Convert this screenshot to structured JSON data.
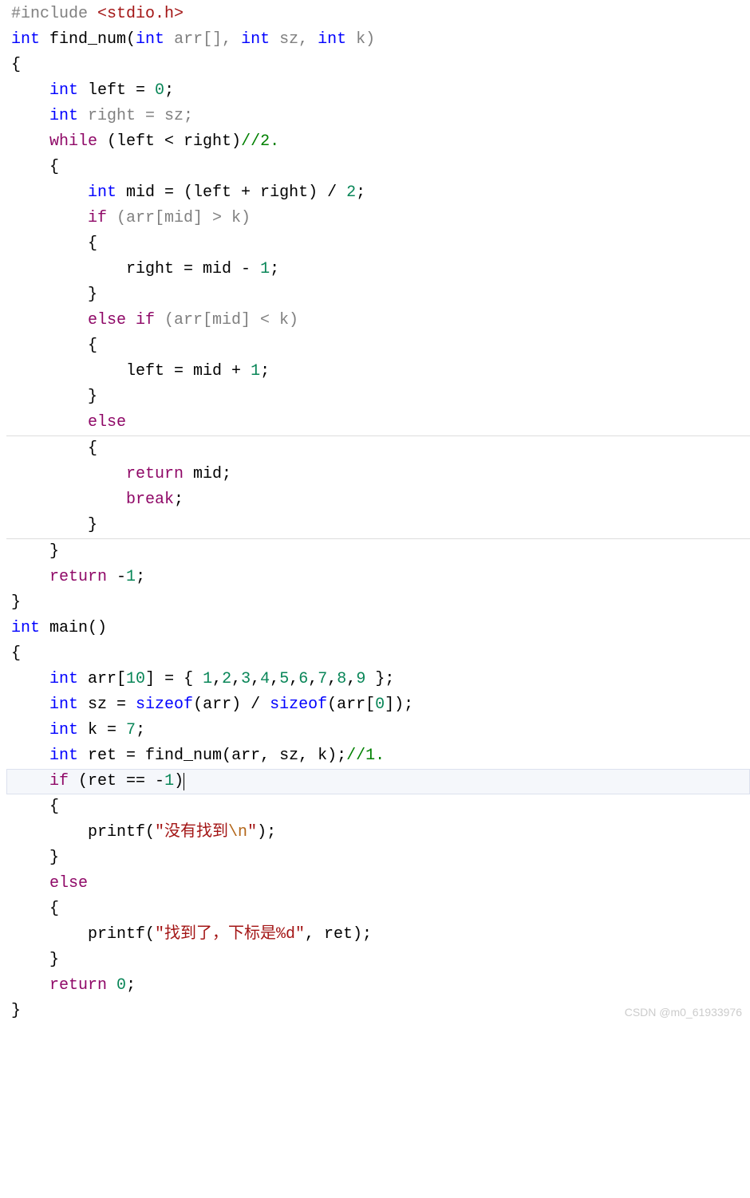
{
  "code": {
    "lines": [
      {
        "indent": 0,
        "segments": [
          {
            "t": "#include ",
            "c": "pp"
          },
          {
            "t": "<stdio.h>",
            "c": "inc"
          }
        ]
      },
      {
        "indent": 0,
        "segments": [
          {
            "t": "int",
            "c": "type"
          },
          {
            "t": " find_num(",
            "c": "func"
          },
          {
            "t": "int",
            "c": "type"
          },
          {
            "t": " arr[], ",
            "c": "var"
          },
          {
            "t": "int",
            "c": "type"
          },
          {
            "t": " sz, ",
            "c": "var"
          },
          {
            "t": "int",
            "c": "type"
          },
          {
            "t": " k)",
            "c": "var"
          }
        ]
      },
      {
        "indent": 0,
        "segments": [
          {
            "t": "{",
            "c": "punct"
          }
        ]
      },
      {
        "indent": 1,
        "segments": [
          {
            "t": "int",
            "c": "type"
          },
          {
            "t": " left = ",
            "c": "op"
          },
          {
            "t": "0",
            "c": "num"
          },
          {
            "t": ";",
            "c": "punct"
          }
        ]
      },
      {
        "indent": 1,
        "segments": [
          {
            "t": "int",
            "c": "type"
          },
          {
            "t": " right = sz;",
            "c": "var"
          }
        ]
      },
      {
        "indent": 1,
        "segments": [
          {
            "t": "while",
            "c": "flow"
          },
          {
            "t": " (left < right)",
            "c": "op"
          },
          {
            "t": "//2.",
            "c": "cmt"
          }
        ]
      },
      {
        "indent": 1,
        "segments": [
          {
            "t": "{",
            "c": "punct"
          }
        ]
      },
      {
        "indent": 2,
        "segments": [
          {
            "t": "int",
            "c": "type"
          },
          {
            "t": " mid = (left + right) / ",
            "c": "op"
          },
          {
            "t": "2",
            "c": "num"
          },
          {
            "t": ";",
            "c": "punct"
          }
        ]
      },
      {
        "indent": 2,
        "segments": [
          {
            "t": "if",
            "c": "flow"
          },
          {
            "t": " (arr[mid] > k)",
            "c": "var"
          }
        ]
      },
      {
        "indent": 2,
        "segments": [
          {
            "t": "{",
            "c": "punct"
          }
        ]
      },
      {
        "indent": 3,
        "segments": [
          {
            "t": "right = mid - ",
            "c": "op"
          },
          {
            "t": "1",
            "c": "num"
          },
          {
            "t": ";",
            "c": "punct"
          }
        ]
      },
      {
        "indent": 2,
        "segments": [
          {
            "t": "}",
            "c": "punct"
          }
        ]
      },
      {
        "indent": 2,
        "segments": [
          {
            "t": "else if",
            "c": "flow"
          },
          {
            "t": " (arr[mid] < k)",
            "c": "var"
          }
        ]
      },
      {
        "indent": 2,
        "segments": [
          {
            "t": "{",
            "c": "punct"
          }
        ]
      },
      {
        "indent": 3,
        "segments": [
          {
            "t": "left = mid + ",
            "c": "op"
          },
          {
            "t": "1",
            "c": "num"
          },
          {
            "t": ";",
            "c": "punct"
          }
        ]
      },
      {
        "indent": 2,
        "segments": [
          {
            "t": "}",
            "c": "punct"
          }
        ]
      },
      {
        "indent": 2,
        "segments": [
          {
            "t": "else",
            "c": "flow"
          }
        ]
      },
      {
        "indent": 2,
        "hl": "block-top",
        "segments": [
          {
            "t": "{",
            "c": "punct"
          }
        ]
      },
      {
        "indent": 3,
        "segments": [
          {
            "t": "return",
            "c": "ret"
          },
          {
            "t": " mid;",
            "c": "op"
          }
        ]
      },
      {
        "indent": 3,
        "segments": [
          {
            "t": "break",
            "c": "ret"
          },
          {
            "t": ";",
            "c": "punct"
          }
        ]
      },
      {
        "indent": 2,
        "hl": "block-bot",
        "segments": [
          {
            "t": "}",
            "c": "punct"
          }
        ]
      },
      {
        "indent": 1,
        "segments": [
          {
            "t": "}",
            "c": "punct"
          }
        ]
      },
      {
        "indent": 1,
        "segments": [
          {
            "t": "return",
            "c": "ret"
          },
          {
            "t": " -",
            "c": "op"
          },
          {
            "t": "1",
            "c": "num"
          },
          {
            "t": ";",
            "c": "punct"
          }
        ]
      },
      {
        "indent": 0,
        "segments": [
          {
            "t": "}",
            "c": "punct"
          }
        ]
      },
      {
        "indent": 0,
        "segments": [
          {
            "t": "int",
            "c": "type"
          },
          {
            "t": " main()",
            "c": "func"
          }
        ]
      },
      {
        "indent": 0,
        "segments": [
          {
            "t": "{",
            "c": "punct"
          }
        ]
      },
      {
        "indent": 1,
        "segments": [
          {
            "t": "int",
            "c": "type"
          },
          {
            "t": " arr[",
            "c": "op"
          },
          {
            "t": "10",
            "c": "num"
          },
          {
            "t": "] = { ",
            "c": "op"
          },
          {
            "t": "1",
            "c": "num"
          },
          {
            "t": ",",
            "c": "punct"
          },
          {
            "t": "2",
            "c": "num"
          },
          {
            "t": ",",
            "c": "punct"
          },
          {
            "t": "3",
            "c": "num"
          },
          {
            "t": ",",
            "c": "punct"
          },
          {
            "t": "4",
            "c": "num"
          },
          {
            "t": ",",
            "c": "punct"
          },
          {
            "t": "5",
            "c": "num"
          },
          {
            "t": ",",
            "c": "punct"
          },
          {
            "t": "6",
            "c": "num"
          },
          {
            "t": ",",
            "c": "punct"
          },
          {
            "t": "7",
            "c": "num"
          },
          {
            "t": ",",
            "c": "punct"
          },
          {
            "t": "8",
            "c": "num"
          },
          {
            "t": ",",
            "c": "punct"
          },
          {
            "t": "9",
            "c": "num"
          },
          {
            "t": " };",
            "c": "punct"
          }
        ]
      },
      {
        "indent": 1,
        "segments": [
          {
            "t": "int",
            "c": "type"
          },
          {
            "t": " sz = ",
            "c": "op"
          },
          {
            "t": "sizeof",
            "c": "kw"
          },
          {
            "t": "(arr) / ",
            "c": "op"
          },
          {
            "t": "sizeof",
            "c": "kw"
          },
          {
            "t": "(arr[",
            "c": "op"
          },
          {
            "t": "0",
            "c": "num"
          },
          {
            "t": "]);",
            "c": "punct"
          }
        ]
      },
      {
        "indent": 1,
        "segments": [
          {
            "t": "int",
            "c": "type"
          },
          {
            "t": " k = ",
            "c": "op"
          },
          {
            "t": "7",
            "c": "num"
          },
          {
            "t": ";",
            "c": "punct"
          }
        ]
      },
      {
        "indent": 1,
        "segments": [
          {
            "t": "int",
            "c": "type"
          },
          {
            "t": " ret = find_num(arr, sz, k);",
            "c": "op"
          },
          {
            "t": "//1.",
            "c": "cmt"
          }
        ]
      },
      {
        "indent": 1,
        "hl": "line",
        "cursor": true,
        "segments": [
          {
            "t": "if",
            "c": "flow"
          },
          {
            "t": " (ret == -",
            "c": "op"
          },
          {
            "t": "1",
            "c": "num"
          },
          {
            "t": ")",
            "c": "op"
          }
        ]
      },
      {
        "indent": 1,
        "segments": [
          {
            "t": "{",
            "c": "punct"
          }
        ]
      },
      {
        "indent": 2,
        "segments": [
          {
            "t": "printf(",
            "c": "func"
          },
          {
            "t": "\"没有找到",
            "c": "str"
          },
          {
            "t": "\\n",
            "c": "esc"
          },
          {
            "t": "\"",
            "c": "str"
          },
          {
            "t": ");",
            "c": "punct"
          }
        ]
      },
      {
        "indent": 1,
        "segments": [
          {
            "t": "}",
            "c": "punct"
          }
        ]
      },
      {
        "indent": 1,
        "segments": [
          {
            "t": "else",
            "c": "flow"
          }
        ]
      },
      {
        "indent": 1,
        "segments": [
          {
            "t": "{",
            "c": "punct"
          }
        ]
      },
      {
        "indent": 2,
        "segments": [
          {
            "t": "printf(",
            "c": "func"
          },
          {
            "t": "\"找到了，下标是%d\"",
            "c": "str"
          },
          {
            "t": ", ret);",
            "c": "op"
          }
        ]
      },
      {
        "indent": 1,
        "segments": [
          {
            "t": "}",
            "c": "punct"
          }
        ]
      },
      {
        "indent": 1,
        "segments": [
          {
            "t": "return",
            "c": "ret"
          },
          {
            "t": " ",
            "c": "op"
          },
          {
            "t": "0",
            "c": "num"
          },
          {
            "t": ";",
            "c": "punct"
          }
        ]
      },
      {
        "indent": 0,
        "segments": [
          {
            "t": "}",
            "c": "punct"
          }
        ]
      }
    ]
  },
  "watermark": "CSDN @m0_61933976",
  "indent_unit": "    "
}
